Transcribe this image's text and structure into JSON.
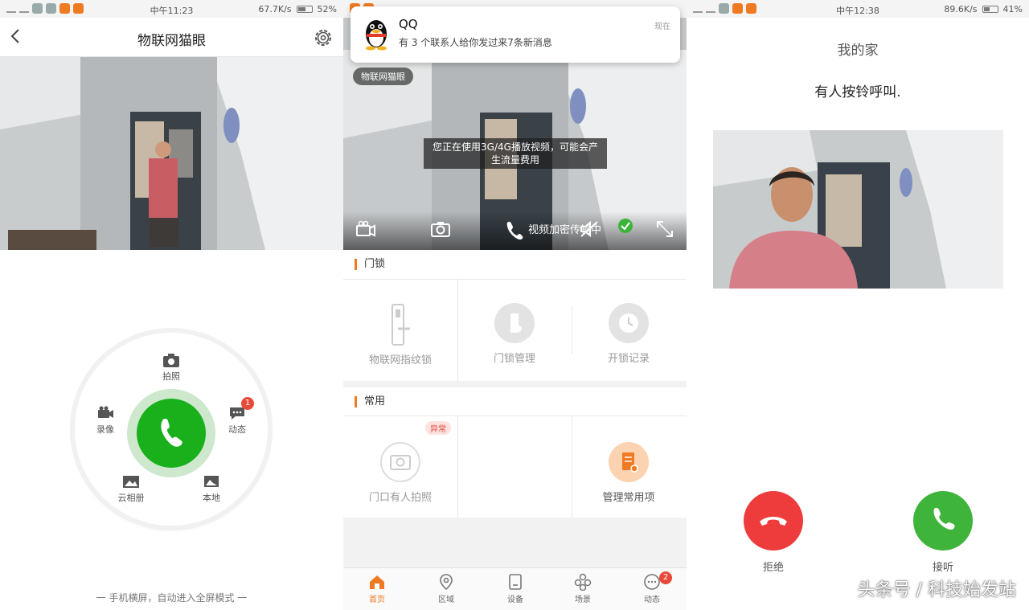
{
  "status_left": {
    "time": "中午11:23",
    "speed": "67.7K/s",
    "battery": "52%"
  },
  "status_right": {
    "time": "中午12:38",
    "speed": "89.6K/s",
    "battery": "41%"
  },
  "p1": {
    "title": "物联网猫眼",
    "dial": {
      "photo": "拍照",
      "record": "录像",
      "activity": "动态",
      "activity_badge": "1",
      "cloud_album": "云相册",
      "local": "本地"
    },
    "hint": "一 手机横屏，自动进入全屏模式 一"
  },
  "p2": {
    "notification": {
      "app": "QQ",
      "message": "有 3 个联系人给你发过来7条新消息",
      "time": "现在"
    },
    "video_tag": "物联网猫眼",
    "warning": "您正在使用3G/4G播放视频，可能会产生流量费用",
    "encrypt_text": "视频加密传输中",
    "lock_section": {
      "title": "门锁",
      "items": [
        "物联网指纹锁",
        "门锁管理",
        "开锁记录"
      ]
    },
    "common_section": {
      "title": "常用",
      "abnormal_tag": "异常",
      "items": [
        "门口有人拍照",
        "管理常用项"
      ]
    },
    "tabs": [
      {
        "label": "首页",
        "icon": "home-icon"
      },
      {
        "label": "区域",
        "icon": "location-icon"
      },
      {
        "label": "设备",
        "icon": "device-icon"
      },
      {
        "label": "场景",
        "icon": "scene-icon"
      },
      {
        "label": "动态",
        "icon": "message-icon",
        "badge": "2"
      }
    ]
  },
  "p3": {
    "home": "我的家",
    "message": "有人按铃呼叫.",
    "decline": "拒绝",
    "answer": "接听",
    "watermark": "头条号 / 科技始发站"
  },
  "colors": {
    "accent": "#f07a22",
    "call_green": "#19b01b",
    "decline_red": "#ee3b3b",
    "answer_green": "#3fb43a"
  }
}
